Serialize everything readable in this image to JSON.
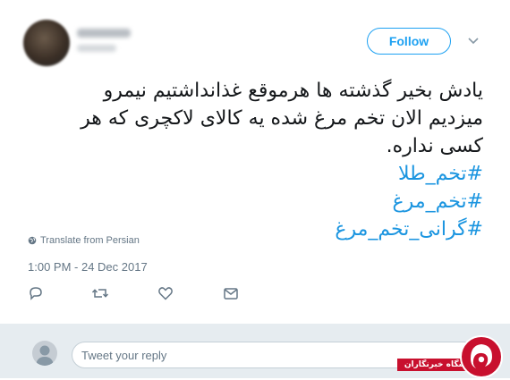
{
  "tweet": {
    "follow_label": "Follow",
    "text_lines": [
      "یادش بخیر گذشته ها هرموقع غذانداشتیم نیمرو",
      "میزدیم الان تخم مرغ شده یه کالای لاکچری که هر",
      "کسی نداره."
    ],
    "hashtags": [
      "#تخم_طلا",
      "#تخم_مرغ",
      "#گرانی_تخم_مرغ"
    ],
    "translate_label": "Translate from Persian",
    "timestamp": "1:00 PM - 24 Dec 2017"
  },
  "reply": {
    "placeholder": "Tweet your reply"
  },
  "watermark": {
    "text": "باشگاه خبرنگاران"
  },
  "colors": {
    "accent": "#1da1f2",
    "hashtag": "#1b95e0",
    "muted": "#657786",
    "reply_bg": "#e6ecf0",
    "watermark_red": "#c8102e"
  },
  "icons": [
    "chevron-down-icon",
    "globe-icon",
    "reply-icon",
    "retweet-icon",
    "like-icon",
    "message-icon"
  ]
}
